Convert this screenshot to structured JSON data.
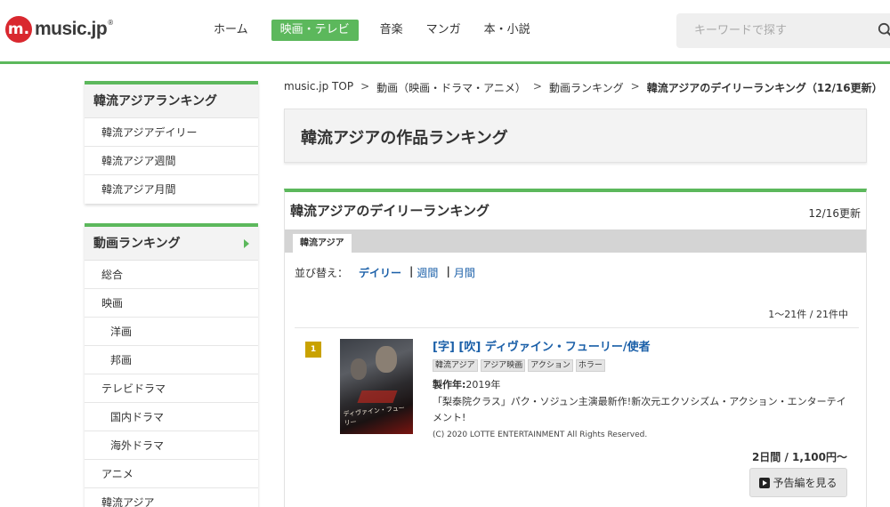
{
  "header": {
    "logo_mark": "m.",
    "logo_text": "music.jp",
    "logo_reg": "®",
    "nav": [
      "ホーム",
      "映画・テレビ",
      "音楽",
      "マンガ",
      "本・小説"
    ],
    "active_nav": "映画・テレビ",
    "search_placeholder": "キーワードで探す"
  },
  "sidebar": {
    "box1": {
      "title": "韓流アジアランキング",
      "items": [
        "韓流アジアデイリー",
        "韓流アジア週間",
        "韓流アジア月間"
      ]
    },
    "box2": {
      "title": "動画ランキング",
      "items": [
        {
          "label": "総合",
          "sub": false
        },
        {
          "label": "映画",
          "sub": false
        },
        {
          "label": "洋画",
          "sub": true
        },
        {
          "label": "邦画",
          "sub": true
        },
        {
          "label": "テレビドラマ",
          "sub": false
        },
        {
          "label": "国内ドラマ",
          "sub": true
        },
        {
          "label": "海外ドラマ",
          "sub": true
        },
        {
          "label": "アニメ",
          "sub": false
        },
        {
          "label": "韓流アジア",
          "sub": false
        }
      ]
    }
  },
  "breadcrumb": {
    "items": [
      "music.jp TOP",
      "動画（映画・ドラマ・アニメ）",
      "動画ランキング"
    ],
    "current": "韓流アジアのデイリーランキング（12/16更新）",
    "separator": ">"
  },
  "page_title": "韓流アジアの作品ランキング",
  "ranking": {
    "title": "韓流アジアのデイリーランキング",
    "updated": "12/16更新",
    "tab": "韓流アジア",
    "sort_label": "並び替え：",
    "sort_options": [
      "デイリー",
      "週間",
      "月間"
    ],
    "count": "1〜21件 /  21件中",
    "items": [
      {
        "rank": "1",
        "poster_text": "ディヴァイン・フューリー",
        "title": "[字] [吹] ディヴァイン・フューリー/使者",
        "tags": [
          "韓流アジア",
          "アジア映画",
          "アクション",
          "ホラー"
        ],
        "year_label": "製作年:",
        "year": "2019年",
        "description": "「梨泰院クラス」パク・ソジュン主演最新作!新次元エクソシズム・アクション・エンターテイメント!",
        "copyright": "(C) 2020 LOTTE ENTERTAINMENT All Rights Reserved.",
        "price": "2日間 / 1,100円〜",
        "trailer_label": "予告編を見る"
      }
    ]
  },
  "colors": {
    "accent_green": "#5cb85c",
    "link_blue": "#1a5fa8",
    "rank_gold": "#c9a200",
    "logo_red": "#d9282f"
  }
}
